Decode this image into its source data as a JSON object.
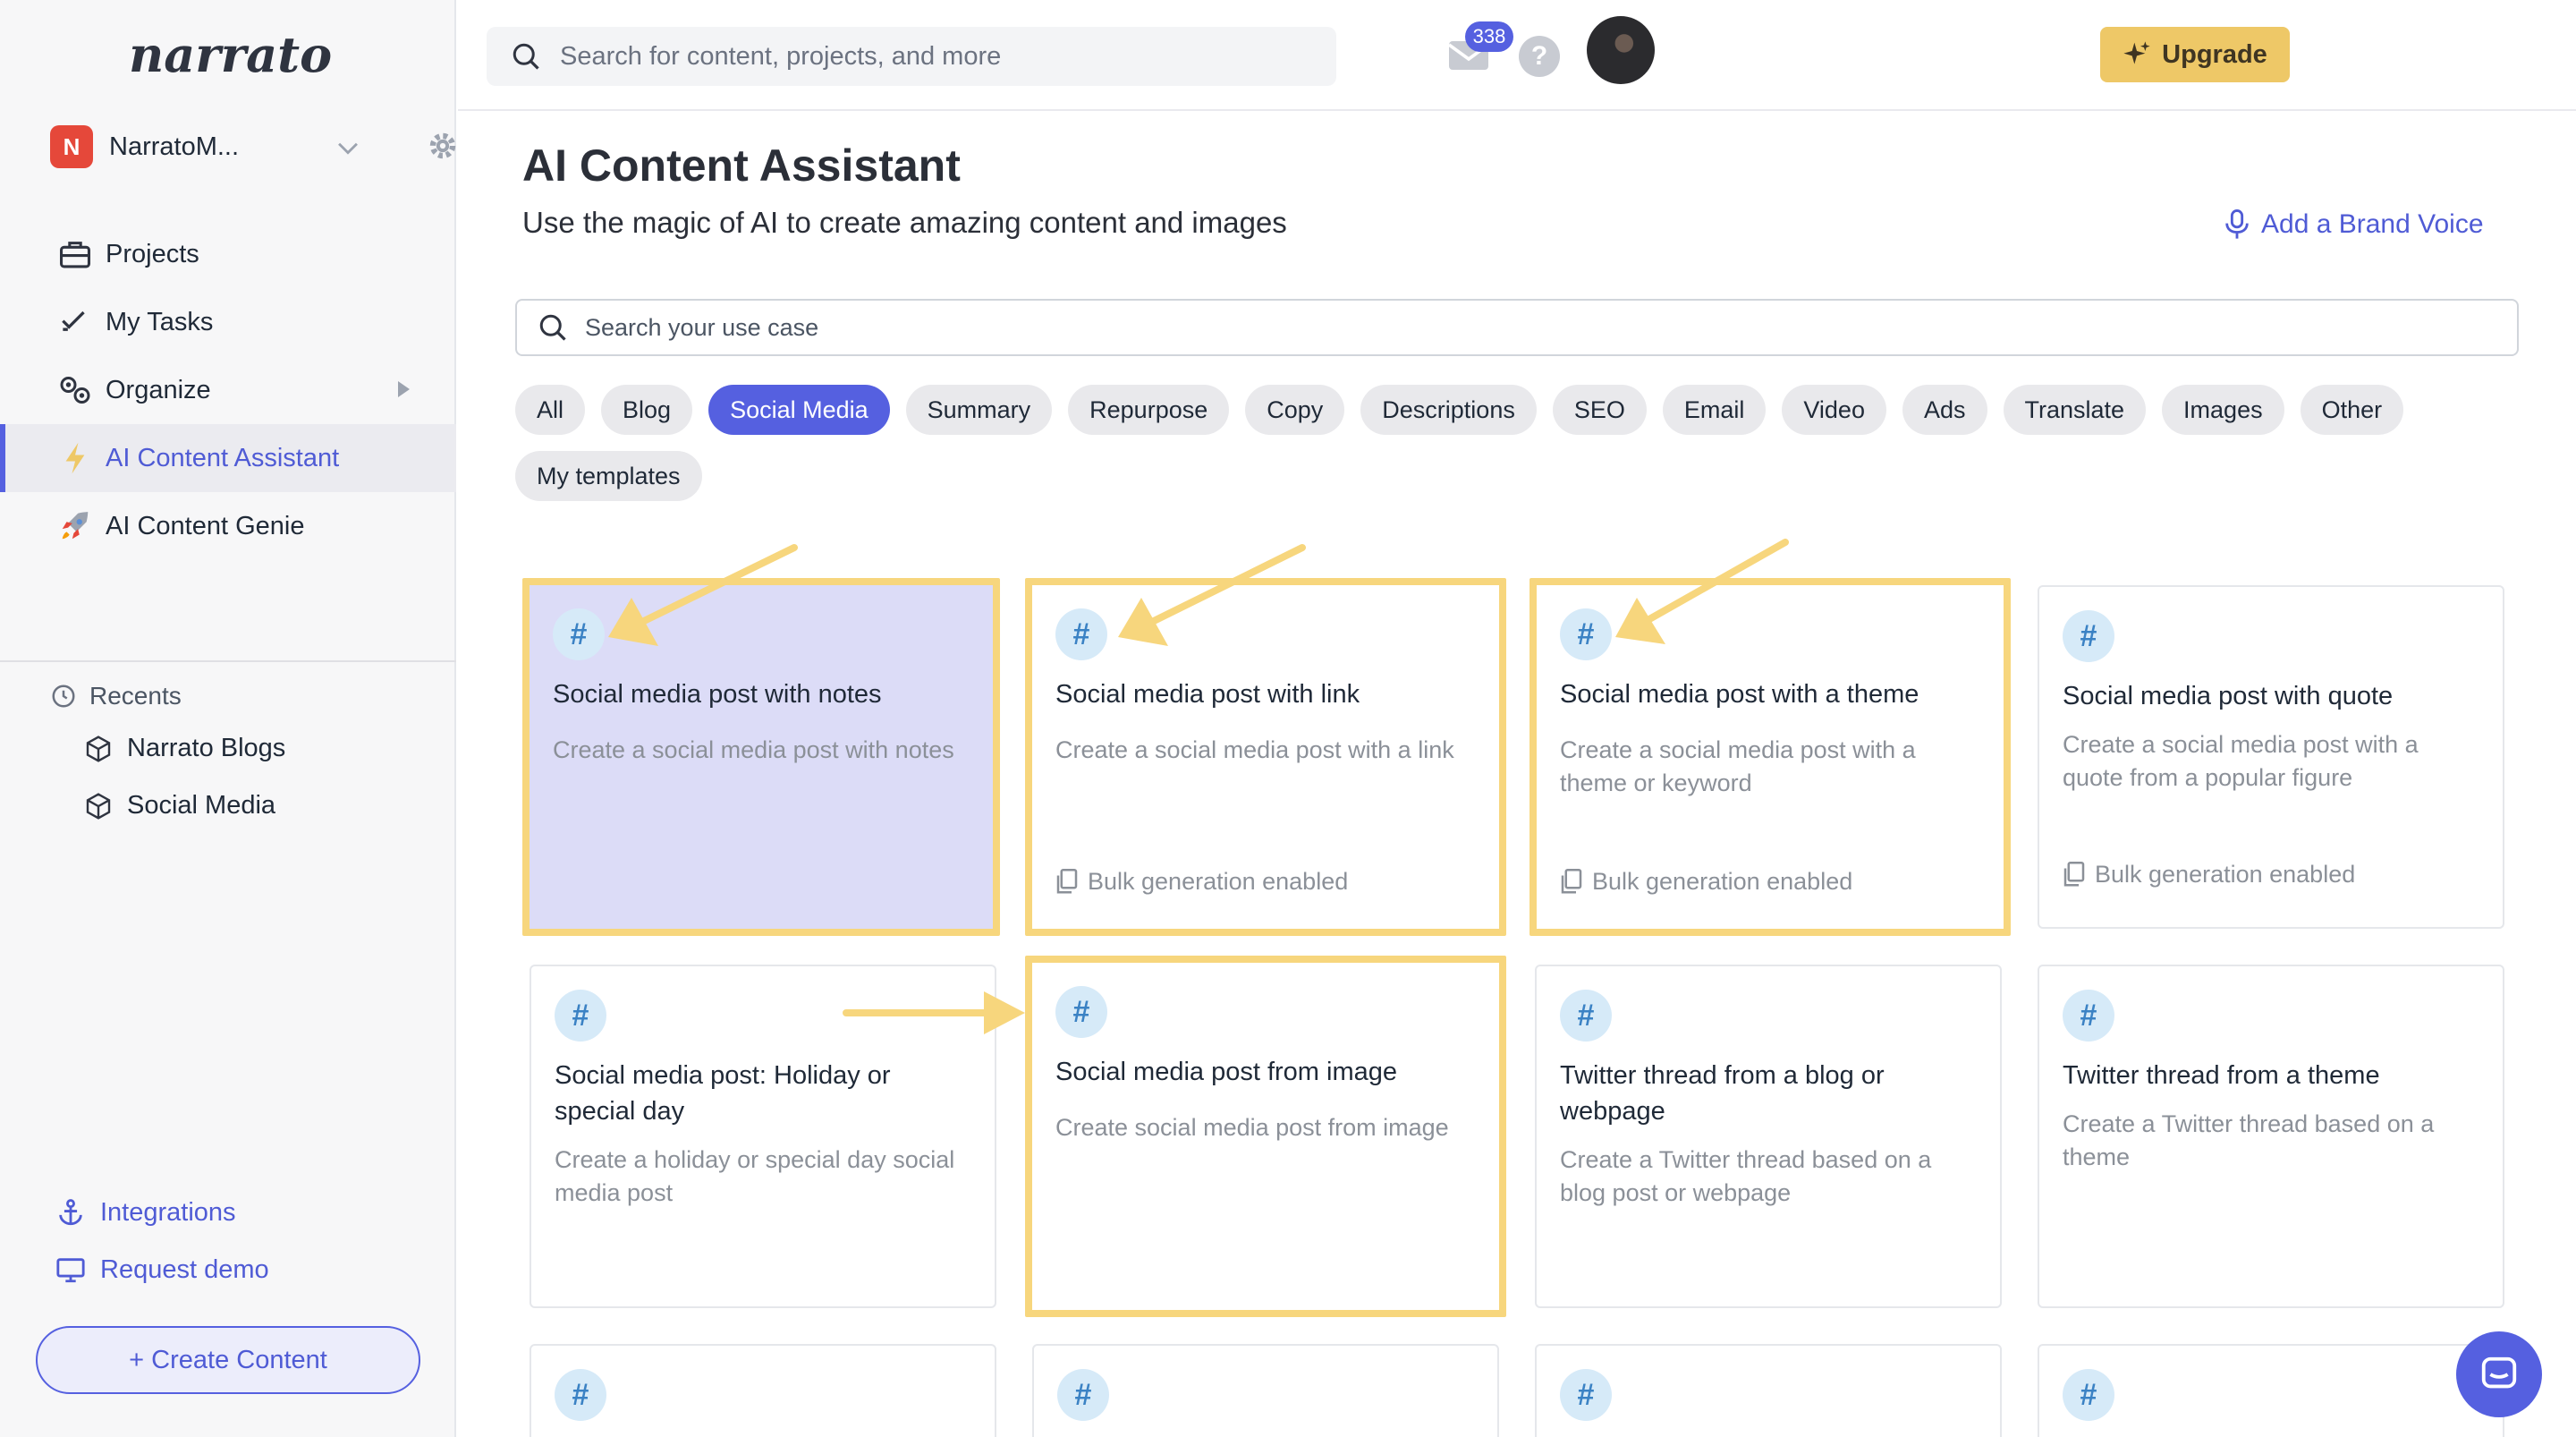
{
  "app": {
    "logo_text": "narrato",
    "workspace": {
      "initial": "N",
      "name": "NarratoM..."
    }
  },
  "sidebar": {
    "items": [
      {
        "label": "Projects",
        "icon": "briefcase-icon"
      },
      {
        "label": "My Tasks",
        "icon": "checkmark-icon"
      },
      {
        "label": "Organize",
        "icon": "gears-icon"
      },
      {
        "label": "AI Content Assistant",
        "icon": "lightning-icon",
        "active": true
      },
      {
        "label": "AI Content Genie",
        "icon": "rocket-icon"
      }
    ],
    "recents_title": "Recents",
    "recents": [
      {
        "label": "Narrato Blogs",
        "icon": "cube-icon"
      },
      {
        "label": "Social Media",
        "icon": "cube-icon"
      }
    ],
    "integrations_label": "Integrations",
    "request_demo_label": "Request demo",
    "create_content_label": "+ Create Content"
  },
  "topbar": {
    "search_placeholder": "Search for content, projects, and more",
    "upgrade_label": "Upgrade",
    "mail_count": "338",
    "help_label": "?"
  },
  "main": {
    "title": "AI Content Assistant",
    "subtitle": "Use the magic of AI to create amazing content and images",
    "brand_voice_label": "Add a Brand Voice",
    "usecase_search_placeholder": "Search your use case",
    "chips": [
      {
        "label": "All"
      },
      {
        "label": "Blog"
      },
      {
        "label": "Social Media",
        "active": true
      },
      {
        "label": "Summary"
      },
      {
        "label": "Repurpose"
      },
      {
        "label": "Copy"
      },
      {
        "label": "Descriptions"
      },
      {
        "label": "SEO"
      },
      {
        "label": "Email"
      },
      {
        "label": "Video"
      },
      {
        "label": "Ads"
      },
      {
        "label": "Translate"
      },
      {
        "label": "Images"
      },
      {
        "label": "Other"
      },
      {
        "label": "My templates"
      }
    ],
    "card_icon": "#",
    "bulk_label": "Bulk generation enabled",
    "cards": [
      {
        "title": "Social media post with notes",
        "desc": "Create a social media post with notes",
        "bulk": false,
        "highlighted": true,
        "selected": true
      },
      {
        "title": "Social media post with link",
        "desc": "Create a social media post with a link",
        "bulk": true,
        "highlighted": true
      },
      {
        "title": "Social media post with a theme",
        "desc": "Create a social media post with a theme or keyword",
        "bulk": true,
        "highlighted": true
      },
      {
        "title": "Social media post with quote",
        "desc": "Create a social media post with a quote from a popular figure",
        "bulk": true,
        "highlighted": false
      },
      {
        "title": "Social media post: Holiday or special day",
        "desc": "Create a holiday or special day social media post",
        "bulk": false,
        "highlighted": false
      },
      {
        "title": "Social media post from image",
        "desc": "Create social media post from image",
        "bulk": false,
        "highlighted": true
      },
      {
        "title": "Twitter thread from a blog or webpage",
        "desc": "Create a Twitter thread based on a blog post or webpage",
        "bulk": false,
        "highlighted": false
      },
      {
        "title": "Twitter thread from a theme",
        "desc": "Create a Twitter thread based on a theme",
        "bulk": false,
        "highlighted": false
      }
    ]
  },
  "colors": {
    "accent": "#5560e0",
    "highlight_border": "#f7d67d",
    "upgrade_bg": "#eec867",
    "selected_card_bg": "#dcdcf7"
  }
}
